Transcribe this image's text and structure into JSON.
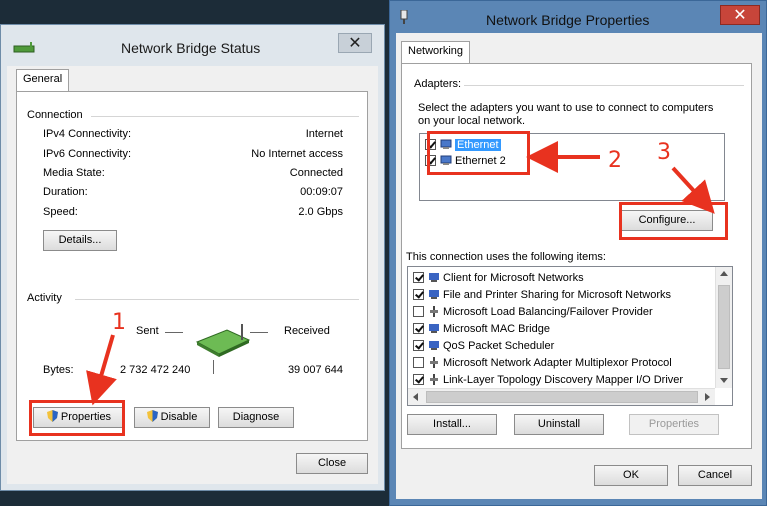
{
  "status_window": {
    "title": "Network Bridge Status",
    "close_glyph": "✕",
    "tab": "General",
    "connection": {
      "heading": "Connection",
      "rows": [
        {
          "label": "IPv4 Connectivity:",
          "value": "Internet"
        },
        {
          "label": "IPv6 Connectivity:",
          "value": "No Internet access"
        },
        {
          "label": "Media State:",
          "value": "Connected"
        },
        {
          "label": "Duration:",
          "value": "00:09:07"
        },
        {
          "label": "Speed:",
          "value": "2.0 Gbps"
        }
      ],
      "details_button": "Details..."
    },
    "activity": {
      "heading": "Activity",
      "sent_label": "Sent",
      "received_label": "Received",
      "bytes_label": "Bytes:",
      "bytes_sent": "2 732 472 240",
      "bytes_received": "39 007 644"
    },
    "buttons": {
      "properties": "Properties",
      "disable": "Disable",
      "diagnose": "Diagnose",
      "close": "Close"
    }
  },
  "properties_window": {
    "title": "Network Bridge Properties",
    "close_glyph": "✕",
    "tab": "Networking",
    "adapters_heading": "Adapters:",
    "adapters_instruction": "Select the adapters you want to use to connect to computers on your local network.",
    "adapters": [
      {
        "name": "Ethernet",
        "checked": true,
        "selected": true
      },
      {
        "name": "Ethernet 2",
        "checked": true,
        "selected": false
      }
    ],
    "configure_button": "Configure...",
    "items_heading": "This connection uses the following items:",
    "items": [
      {
        "name": "Client for Microsoft Networks",
        "checked": true
      },
      {
        "name": "File and Printer Sharing for Microsoft Networks",
        "checked": true
      },
      {
        "name": "Microsoft Load Balancing/Failover Provider",
        "checked": false
      },
      {
        "name": "Microsoft MAC Bridge",
        "checked": true
      },
      {
        "name": "QoS Packet Scheduler",
        "checked": true
      },
      {
        "name": "Microsoft Network Adapter Multiplexor Protocol",
        "checked": false
      },
      {
        "name": "Link-Layer Topology Discovery Mapper I/O Driver",
        "checked": true
      }
    ],
    "buttons": {
      "install": "Install...",
      "uninstall": "Uninstall",
      "properties": "Properties",
      "ok": "OK",
      "cancel": "Cancel"
    }
  },
  "annotations": {
    "step1": "1",
    "step2": "2",
    "step3": "3"
  },
  "colors": {
    "annotation_red": "#e8321f",
    "selection_blue": "#3399ff",
    "titlebar_blue": "#5b86b5"
  }
}
